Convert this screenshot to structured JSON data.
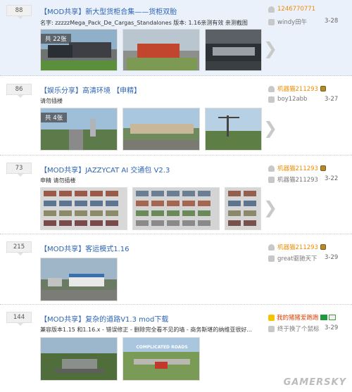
{
  "threads": [
    {
      "count": "88",
      "title": "【MOD共享】新大型货柜合集——货柜双胎",
      "desc": "名字: zzzzzMega_Pack_De_Cargas_Standalones 版本: 1.16亲测有效 亲测截图",
      "badge": "共 22张",
      "author": "1246770771",
      "replier": "windy田午",
      "date": "3-28"
    },
    {
      "count": "86",
      "title": "【娱乐分享】高清环境 【申精】",
      "desc": "请勿插楼",
      "badge": "共 4张",
      "author": "机器猫211293",
      "replier": "boy12abb",
      "date": "3-27"
    },
    {
      "count": "73",
      "title": "【MOD共享】JAZZYCAT AI 交通包 V2.3",
      "desc": "申精 请勿插楼",
      "badge": "",
      "author": "机器猫211293",
      "replier": "机器猫211293",
      "date": "3-22"
    },
    {
      "count": "215",
      "title": "【MOD共享】客运模式1.16",
      "desc": "",
      "badge": "",
      "author": "机器猫211293",
      "replier": "great驱驰天下",
      "date": "3-29"
    },
    {
      "count": "144",
      "title": "【MOD共享】复杂的道路V1.3 mod下载",
      "desc": "兼容版本1.15 和1.16.x - 错误修正 - 删除完全看不见的墙 - 商务斯堪的纳维亚很好...",
      "badge": "",
      "author": "我的猪猪爱跑跑",
      "replier": "终于换了个鼠标",
      "date": "3-29"
    }
  ],
  "watermark": "GAMERSKY",
  "thumb_caption": "COMPLICATED ROADS"
}
